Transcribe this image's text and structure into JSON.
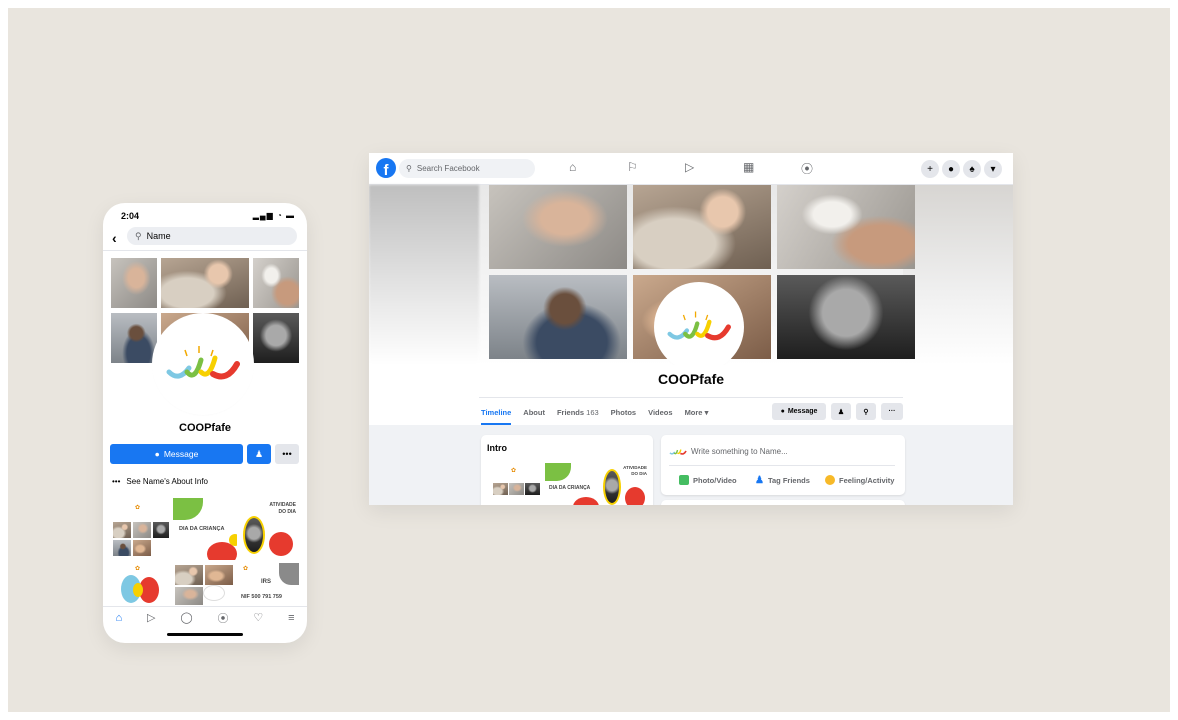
{
  "phone": {
    "time": "2:04",
    "status_icons": "▂▄▆ ◔ ▬",
    "back_icon": "‹",
    "search_value": "Name",
    "profile_name": "COOPfafe",
    "message_label": "Message",
    "add_icon": "➕",
    "more_label": "•••",
    "about_prefix": "•••",
    "about_label": "See Name's About Info",
    "poster_dia": "DIA DA CRIANÇA",
    "poster_atividade_1": "ATIVIDADE",
    "poster_atividade_2": "DO DIA",
    "poster_irs": "IRS",
    "poster_nif": "NIF 500 791 759",
    "nav_icons": [
      "home-icon",
      "watch-icon",
      "profile-icon",
      "groups-icon",
      "bell-icon",
      "menu-icon"
    ]
  },
  "desktop": {
    "search_placeholder": "Search Facebook",
    "fb_logo": "f",
    "page_name": "COOPfafe",
    "tabs": [
      {
        "label": "Timeline",
        "active": true
      },
      {
        "label": "About"
      },
      {
        "label": "Friends",
        "count": "163"
      },
      {
        "label": "Photos"
      },
      {
        "label": "Videos"
      },
      {
        "label": "More ▾"
      }
    ],
    "message_label": "Message",
    "more_label": "···",
    "intro_title": "Intro",
    "compose_placeholder": "Write something to Name...",
    "photo_video_label": "Photo/Video",
    "tag_friends_label": "Tag Friends",
    "feeling_label": "Feeling/Activity",
    "poster_dia": "DIA DA CRIANÇA",
    "poster_atividade_1": "ATIVIDADE",
    "poster_atividade_2": "DO DIA"
  },
  "colors": {
    "facebook_blue": "#1877f2",
    "background": "#e9e5de",
    "logo_green": "#7bc043",
    "logo_red": "#e63a2e",
    "logo_yellow": "#f7d000",
    "logo_blue": "#7ec8e3"
  }
}
